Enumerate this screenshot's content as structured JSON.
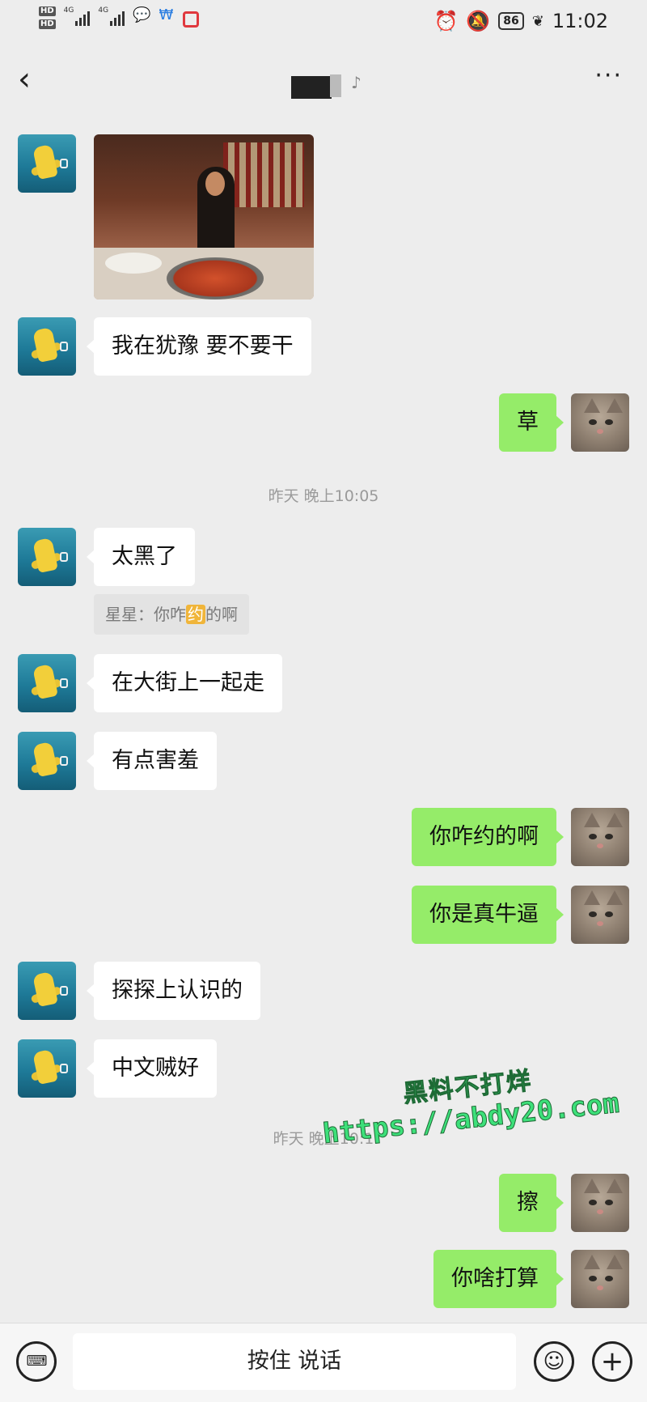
{
  "status_bar": {
    "network_left": [
      "HD",
      "HD"
    ],
    "network_labels": [
      "4G",
      "4G"
    ],
    "battery": "86",
    "time": "11:02",
    "icons": [
      "alarm-icon",
      "bell-off-icon",
      "battery-icon",
      "leaf-icon"
    ]
  },
  "nav": {
    "back_icon": "chevron-left-icon",
    "more_icon": "more-dots-icon",
    "more_label": "···"
  },
  "messages": [
    {
      "side": "left",
      "type": "image"
    },
    {
      "side": "left",
      "text": "我在犹豫 要不要干"
    },
    {
      "side": "right",
      "text": "草"
    },
    {
      "side": "left",
      "text": "太黑了"
    },
    {
      "side": "left",
      "text": "在大街上一起走"
    },
    {
      "side": "left",
      "text": "有点害羞"
    },
    {
      "side": "right",
      "text": "你咋约的啊"
    },
    {
      "side": "right",
      "text": "你是真牛逼"
    },
    {
      "side": "left",
      "text": "探探上认识的"
    },
    {
      "side": "left",
      "text": "中文贼好"
    },
    {
      "side": "right",
      "text": "擦"
    },
    {
      "side": "right",
      "text": "你啥打算"
    }
  ],
  "timestamps": {
    "first": "昨天 晚上10:05",
    "second": "昨天 晚上10:1"
  },
  "quote": {
    "prefix": "星星：你咋",
    "highlight": "约",
    "suffix": "的啊"
  },
  "watermark": {
    "line1": "黑料不打烊",
    "line2": "https://abdy20.com"
  },
  "input_bar": {
    "keyboard_icon": "keyboard-icon",
    "keyboard_glyph": "⌨",
    "hold_to_talk": "按住 说话",
    "emoji_icon": "emoji-icon",
    "emoji_glyph": "☺",
    "plus_icon": "plus-icon",
    "plus_glyph": "+"
  }
}
